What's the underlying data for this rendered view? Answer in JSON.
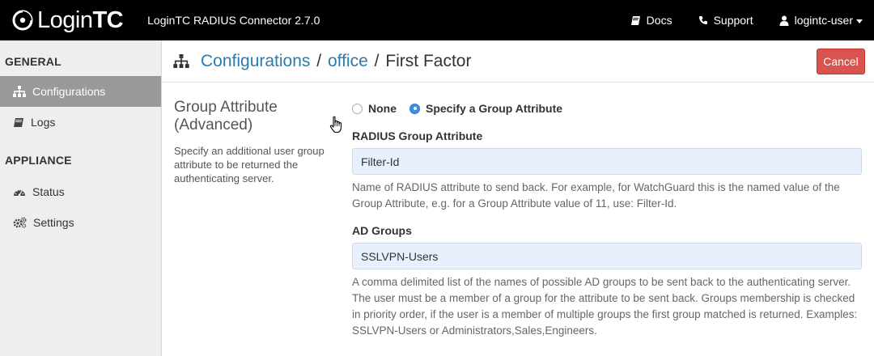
{
  "navbar": {
    "brand_light": "Login",
    "brand_bold": "TC",
    "product_title": "LoginTC RADIUS Connector 2.7.0",
    "docs_label": "Docs",
    "support_label": "Support",
    "user_label": "logintc-user"
  },
  "sidebar": {
    "general_heading": "GENERAL",
    "appliance_heading": "APPLIANCE",
    "items": {
      "configurations": "Configurations",
      "logs": "Logs",
      "status": "Status",
      "settings": "Settings"
    }
  },
  "header": {
    "crumb_configurations": "Configurations",
    "crumb_office": "office",
    "crumb_current": "First Factor",
    "separator": "/",
    "cancel_label": "Cancel"
  },
  "section": {
    "title": "Group Attribute (Advanced)",
    "description": "Specify an additional user group attribute to be returned the authenticating server."
  },
  "options": {
    "none_label": "None",
    "specify_label": "Specify a Group Attribute",
    "selected": "Specify a Group Attribute"
  },
  "radius_field": {
    "label": "RADIUS Group Attribute",
    "value": "Filter-Id",
    "help": "Name of RADIUS attribute to send back. For example, for WatchGuard this is the named value of the Group Attribute, e.g. for a Group Attribute value of 11, use: Filter-Id."
  },
  "ad_field": {
    "label": "AD Groups",
    "value": "SSLVPN-Users",
    "help": "A comma delimited list of the names of possible AD groups to be sent back to the authenticating server. The user must be a member of a group for the attribute to be sent back. Groups membership is checked in priority order, if the user is a member of multiple groups the first group matched is returned. Examples: SSLVPN-Users or Administrators,Sales,Engineers."
  },
  "colors": {
    "navbar_bg": "#000000",
    "sidebar_bg": "#eeeeee",
    "sidebar_active_bg": "#999999",
    "link": "#2a7bb0",
    "cancel_bg": "#d9534f",
    "input_bg": "#e9f0fd",
    "radio_checked": "#3c8fe0"
  },
  "icons": {
    "brand": "logintc-logo-icon",
    "docs": "book-icon",
    "support": "phone-icon",
    "user": "user-icon",
    "configurations": "sitemap-icon",
    "logs": "book-icon",
    "status": "dashboard-icon",
    "settings": "gears-icon",
    "pointer": "hand-pointer-icon"
  }
}
